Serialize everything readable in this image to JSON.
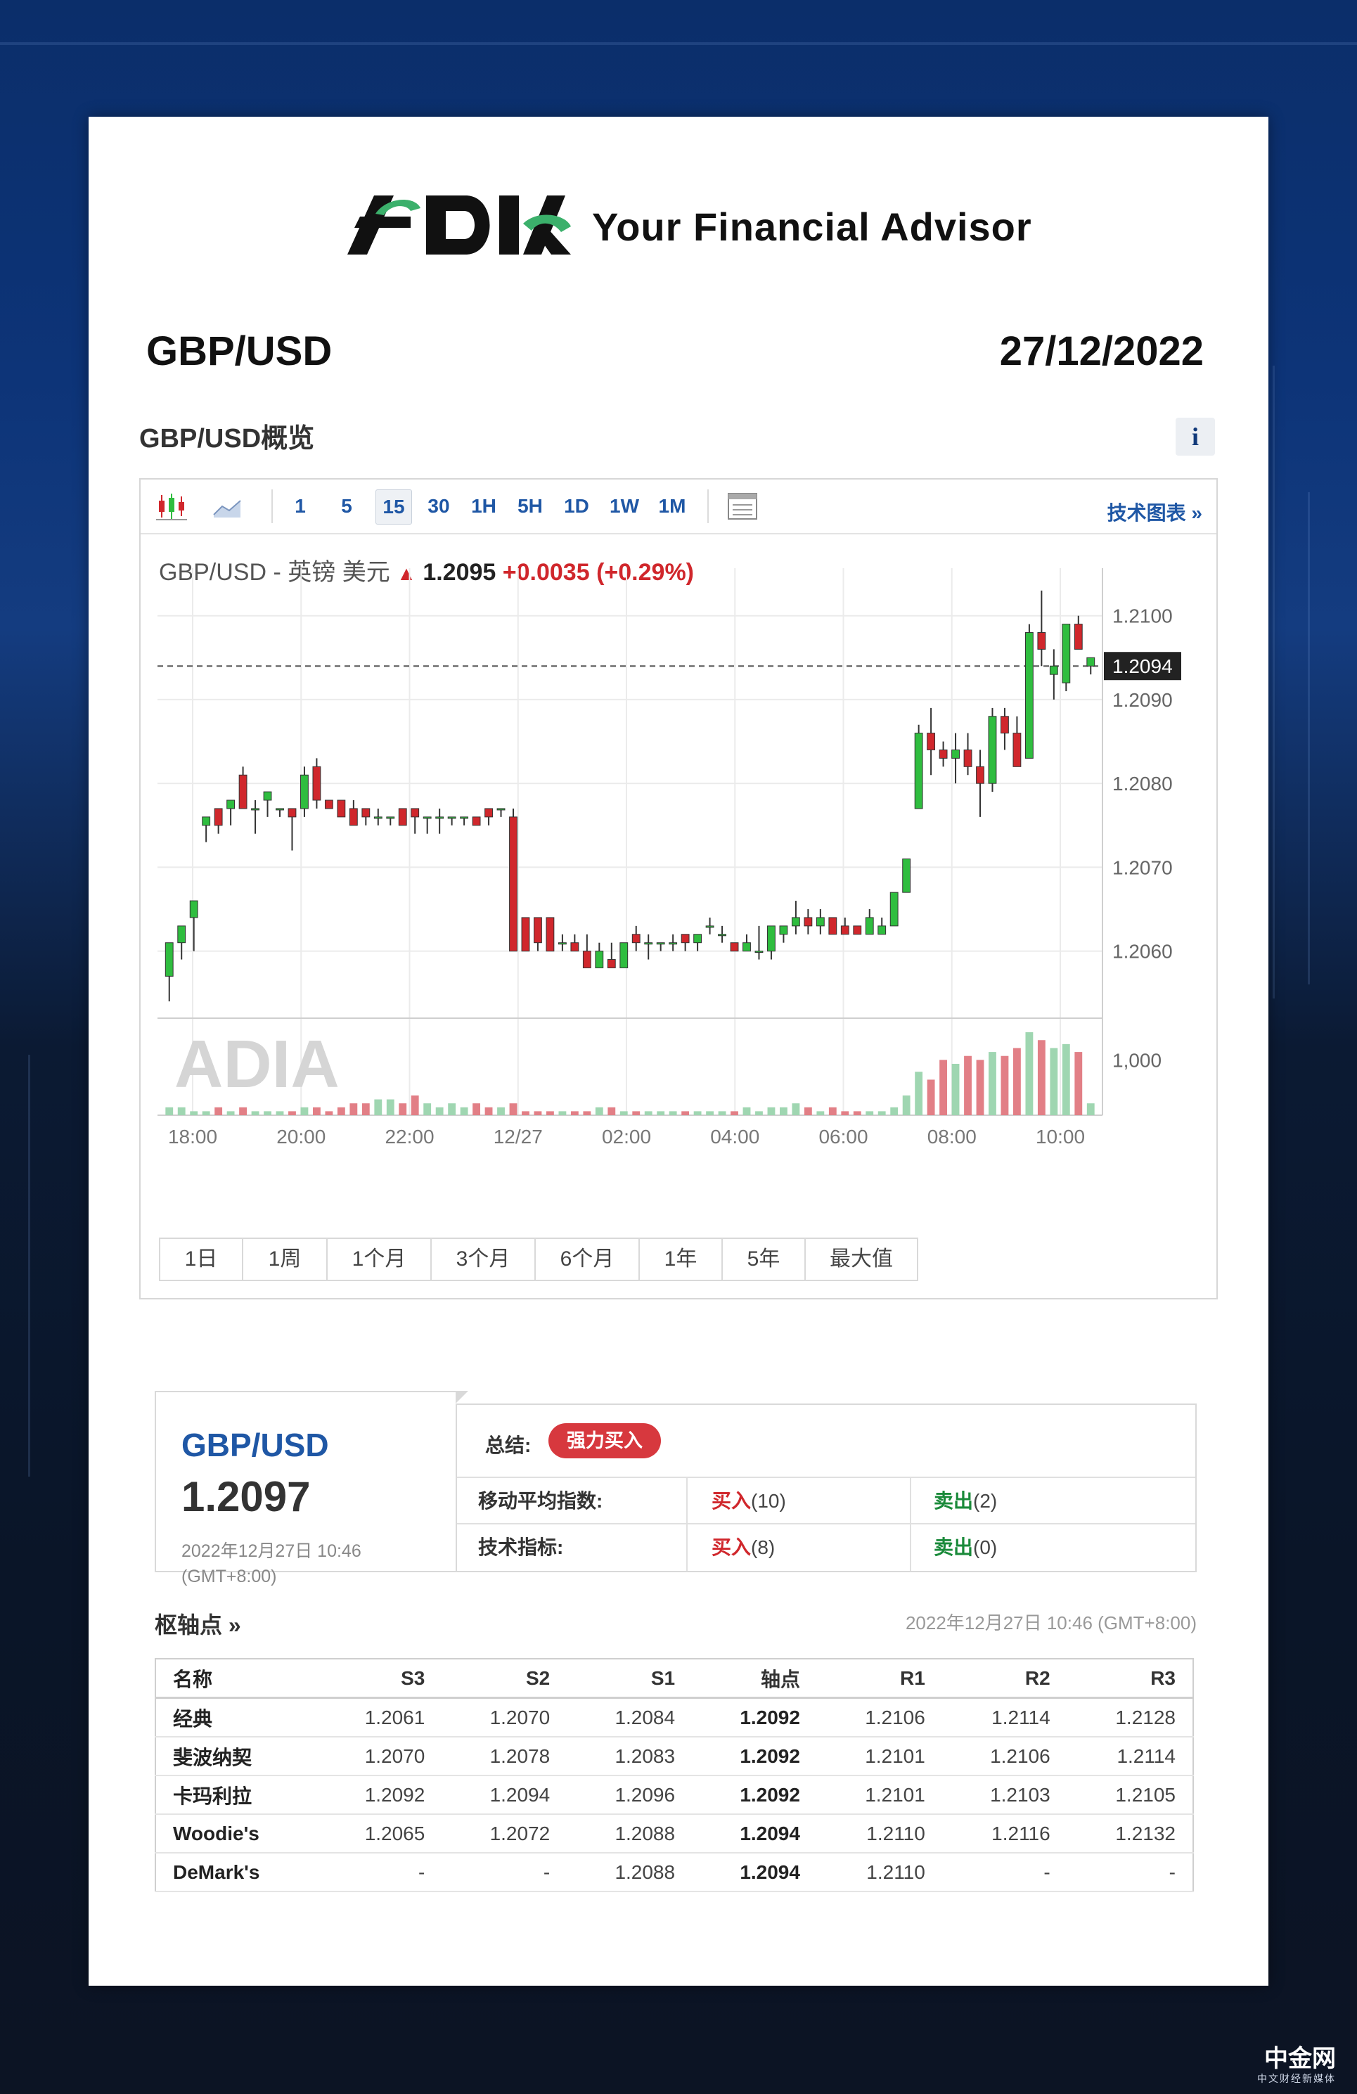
{
  "brand": {
    "tagline": "Your Financial Advisor",
    "logo_text": "ADIA"
  },
  "header": {
    "pair": "GBP/USD",
    "date": "27/12/2022"
  },
  "overview": {
    "title": "GBP/USD概览",
    "info_label": "i"
  },
  "toolbar": {
    "intervals": [
      "1",
      "5",
      "15",
      "30",
      "1H",
      "5H",
      "1D",
      "1W",
      "1M"
    ],
    "active_interval": "15",
    "tech_link": "技术图表 »"
  },
  "quote": {
    "name": "GBP/USD - 英镑 美元",
    "price": "1.2095",
    "change": "+0.0035",
    "change_pct": "(+0.29%)"
  },
  "chart_data": {
    "type": "candlestick",
    "x_tick_labels": [
      "18:00",
      "20:00",
      "22:00",
      "12/27",
      "02:00",
      "04:00",
      "06:00",
      "08:00",
      "10:00"
    ],
    "y_tick_labels": [
      "1.2100",
      "1.2090",
      "1.2080",
      "1.2070",
      "1.2060"
    ],
    "ylim": [
      1.2052,
      1.2104
    ],
    "current_price_label": "1.2094",
    "current_price": 1.2094,
    "volume_tick_label": "1,000",
    "watermark": "ADIA",
    "colors": {
      "up": "#2fbd3f",
      "down": "#d0272c",
      "vol_up": "#9fd6b1",
      "vol_down": "#e27f86",
      "grid": "#ebebeb"
    },
    "candles": [
      {
        "o": 1.2057,
        "h": 1.2061,
        "l": 1.2054,
        "c": 1.2061,
        "v": 2
      },
      {
        "o": 1.2061,
        "h": 1.2063,
        "l": 1.2059,
        "c": 1.2063,
        "v": 2
      },
      {
        "o": 1.2064,
        "h": 1.2066,
        "l": 1.206,
        "c": 1.2066,
        "v": 1
      },
      {
        "o": 1.2075,
        "h": 1.2076,
        "l": 1.2073,
        "c": 1.2076,
        "v": 1
      },
      {
        "o": 1.2077,
        "h": 1.2077,
        "l": 1.2074,
        "c": 1.2075,
        "v": 2
      },
      {
        "o": 1.2077,
        "h": 1.2078,
        "l": 1.2075,
        "c": 1.2078,
        "v": 1
      },
      {
        "o": 1.2081,
        "h": 1.2082,
        "l": 1.2077,
        "c": 1.2077,
        "v": 2
      },
      {
        "o": 1.2077,
        "h": 1.2078,
        "l": 1.2074,
        "c": 1.2077,
        "v": 1
      },
      {
        "o": 1.2078,
        "h": 1.2078,
        "l": 1.2076,
        "c": 1.2079,
        "v": 1
      },
      {
        "o": 1.2077,
        "h": 1.2077,
        "l": 1.2076,
        "c": 1.2077,
        "v": 1
      },
      {
        "o": 1.2077,
        "h": 1.2077,
        "l": 1.2072,
        "c": 1.2076,
        "v": 1
      },
      {
        "o": 1.2077,
        "h": 1.2082,
        "l": 1.2076,
        "c": 1.2081,
        "v": 2
      },
      {
        "o": 1.2082,
        "h": 1.2083,
        "l": 1.2077,
        "c": 1.2078,
        "v": 2
      },
      {
        "o": 1.2078,
        "h": 1.2078,
        "l": 1.2077,
        "c": 1.2077,
        "v": 1
      },
      {
        "o": 1.2078,
        "h": 1.2078,
        "l": 1.2076,
        "c": 1.2076,
        "v": 2
      },
      {
        "o": 1.2077,
        "h": 1.2078,
        "l": 1.2075,
        "c": 1.2075,
        "v": 3
      },
      {
        "o": 1.2077,
        "h": 1.2077,
        "l": 1.2075,
        "c": 1.2076,
        "v": 3
      },
      {
        "o": 1.2076,
        "h": 1.2077,
        "l": 1.2075,
        "c": 1.2076,
        "v": 4
      },
      {
        "o": 1.2076,
        "h": 1.2076,
        "l": 1.2075,
        "c": 1.2076,
        "v": 4
      },
      {
        "o": 1.2077,
        "h": 1.2077,
        "l": 1.2075,
        "c": 1.2075,
        "v": 3
      },
      {
        "o": 1.2077,
        "h": 1.2077,
        "l": 1.2074,
        "c": 1.2076,
        "v": 5
      },
      {
        "o": 1.2076,
        "h": 1.2076,
        "l": 1.2074,
        "c": 1.2076,
        "v": 3
      },
      {
        "o": 1.2076,
        "h": 1.2077,
        "l": 1.2074,
        "c": 1.2076,
        "v": 2
      },
      {
        "o": 1.2076,
        "h": 1.2076,
        "l": 1.2075,
        "c": 1.2076,
        "v": 3
      },
      {
        "o": 1.2076,
        "h": 1.2076,
        "l": 1.2075,
        "c": 1.2076,
        "v": 2
      },
      {
        "o": 1.2076,
        "h": 1.2076,
        "l": 1.2075,
        "c": 1.2075,
        "v": 3
      },
      {
        "o": 1.2077,
        "h": 1.2077,
        "l": 1.2075,
        "c": 1.2076,
        "v": 2
      },
      {
        "o": 1.2077,
        "h": 1.2077,
        "l": 1.2076,
        "c": 1.2077,
        "v": 2
      },
      {
        "o": 1.2076,
        "h": 1.2077,
        "l": 1.206,
        "c": 1.206,
        "v": 3
      },
      {
        "o": 1.2064,
        "h": 1.2064,
        "l": 1.206,
        "c": 1.206,
        "v": 1
      },
      {
        "o": 1.2064,
        "h": 1.2064,
        "l": 1.206,
        "c": 1.2061,
        "v": 1
      },
      {
        "o": 1.2064,
        "h": 1.2064,
        "l": 1.206,
        "c": 1.206,
        "v": 1
      },
      {
        "o": 1.2061,
        "h": 1.2062,
        "l": 1.206,
        "c": 1.2061,
        "v": 1
      },
      {
        "o": 1.2061,
        "h": 1.2062,
        "l": 1.206,
        "c": 1.206,
        "v": 1
      },
      {
        "o": 1.206,
        "h": 1.2062,
        "l": 1.2058,
        "c": 1.2058,
        "v": 1
      },
      {
        "o": 1.2058,
        "h": 1.2061,
        "l": 1.2058,
        "c": 1.206,
        "v": 2
      },
      {
        "o": 1.2059,
        "h": 1.2061,
        "l": 1.2058,
        "c": 1.2058,
        "v": 2
      },
      {
        "o": 1.2058,
        "h": 1.2061,
        "l": 1.2058,
        "c": 1.2061,
        "v": 1
      },
      {
        "o": 1.2062,
        "h": 1.2063,
        "l": 1.206,
        "c": 1.2061,
        "v": 1
      },
      {
        "o": 1.2061,
        "h": 1.2062,
        "l": 1.2059,
        "c": 1.2061,
        "v": 1
      },
      {
        "o": 1.2061,
        "h": 1.2061,
        "l": 1.206,
        "c": 1.2061,
        "v": 1
      },
      {
        "o": 1.2061,
        "h": 1.2062,
        "l": 1.206,
        "c": 1.2061,
        "v": 1
      },
      {
        "o": 1.2062,
        "h": 1.2062,
        "l": 1.206,
        "c": 1.2061,
        "v": 1
      },
      {
        "o": 1.2061,
        "h": 1.2062,
        "l": 1.206,
        "c": 1.2062,
        "v": 1
      },
      {
        "o": 1.2063,
        "h": 1.2064,
        "l": 1.2062,
        "c": 1.2063,
        "v": 1
      },
      {
        "o": 1.2062,
        "h": 1.2063,
        "l": 1.2061,
        "c": 1.2062,
        "v": 1
      },
      {
        "o": 1.2061,
        "h": 1.2061,
        "l": 1.206,
        "c": 1.206,
        "v": 1
      },
      {
        "o": 1.206,
        "h": 1.2062,
        "l": 1.206,
        "c": 1.2061,
        "v": 2
      },
      {
        "o": 1.206,
        "h": 1.2063,
        "l": 1.2059,
        "c": 1.206,
        "v": 1
      },
      {
        "o": 1.206,
        "h": 1.2063,
        "l": 1.2059,
        "c": 1.2063,
        "v": 2
      },
      {
        "o": 1.2062,
        "h": 1.2063,
        "l": 1.2061,
        "c": 1.2063,
        "v": 2
      },
      {
        "o": 1.2063,
        "h": 1.2066,
        "l": 1.2062,
        "c": 1.2064,
        "v": 3
      },
      {
        "o": 1.2064,
        "h": 1.2065,
        "l": 1.2062,
        "c": 1.2063,
        "v": 2
      },
      {
        "o": 1.2063,
        "h": 1.2065,
        "l": 1.2062,
        "c": 1.2064,
        "v": 1
      },
      {
        "o": 1.2064,
        "h": 1.2064,
        "l": 1.2062,
        "c": 1.2062,
        "v": 2
      },
      {
        "o": 1.2063,
        "h": 1.2064,
        "l": 1.2062,
        "c": 1.2062,
        "v": 1
      },
      {
        "o": 1.2063,
        "h": 1.2063,
        "l": 1.2062,
        "c": 1.2062,
        "v": 1
      },
      {
        "o": 1.2062,
        "h": 1.2065,
        "l": 1.2062,
        "c": 1.2064,
        "v": 1
      },
      {
        "o": 1.2062,
        "h": 1.2064,
        "l": 1.2062,
        "c": 1.2063,
        "v": 1
      },
      {
        "o": 1.2063,
        "h": 1.2067,
        "l": 1.2063,
        "c": 1.2067,
        "v": 2
      },
      {
        "o": 1.2067,
        "h": 1.2071,
        "l": 1.2067,
        "c": 1.2071,
        "v": 5
      },
      {
        "o": 1.2077,
        "h": 1.2087,
        "l": 1.2077,
        "c": 1.2086,
        "v": 11
      },
      {
        "o": 1.2086,
        "h": 1.2089,
        "l": 1.2081,
        "c": 1.2084,
        "v": 9
      },
      {
        "o": 1.2084,
        "h": 1.2085,
        "l": 1.2082,
        "c": 1.2083,
        "v": 14
      },
      {
        "o": 1.2083,
        "h": 1.2086,
        "l": 1.208,
        "c": 1.2084,
        "v": 13
      },
      {
        "o": 1.2084,
        "h": 1.2086,
        "l": 1.2081,
        "c": 1.2082,
        "v": 15
      },
      {
        "o": 1.2082,
        "h": 1.2084,
        "l": 1.2076,
        "c": 1.208,
        "v": 14
      },
      {
        "o": 1.208,
        "h": 1.2089,
        "l": 1.2079,
        "c": 1.2088,
        "v": 16
      },
      {
        "o": 1.2088,
        "h": 1.2089,
        "l": 1.2084,
        "c": 1.2086,
        "v": 15
      },
      {
        "o": 1.2086,
        "h": 1.2088,
        "l": 1.2082,
        "c": 1.2082,
        "v": 17
      },
      {
        "o": 1.2083,
        "h": 1.2099,
        "l": 1.2083,
        "c": 1.2098,
        "v": 21
      },
      {
        "o": 1.2098,
        "h": 1.2103,
        "l": 1.2094,
        "c": 1.2096,
        "v": 19
      },
      {
        "o": 1.2093,
        "h": 1.2096,
        "l": 1.209,
        "c": 1.2094,
        "v": 17
      },
      {
        "o": 1.2092,
        "h": 1.2099,
        "l": 1.2091,
        "c": 1.2099,
        "v": 18
      },
      {
        "o": 1.2099,
        "h": 1.21,
        "l": 1.2096,
        "c": 1.2096,
        "v": 16
      },
      {
        "o": 1.2094,
        "h": 1.2095,
        "l": 1.2093,
        "c": 1.2095,
        "v": 3
      }
    ]
  },
  "ranges": [
    "1日",
    "1周",
    "1个月",
    "3个月",
    "6个月",
    "1年",
    "5年",
    "最大值"
  ],
  "summary": {
    "pair": "GBP/USD",
    "price": "1.2097",
    "time_line1": "2022年12月27日 10:46",
    "time_line2": "(GMT+8:00)",
    "label": "总结:",
    "badge": "强力买入",
    "rows": [
      {
        "label": "移动平均指数:",
        "buy": "买入",
        "buy_count": "(10)",
        "sell": "卖出",
        "sell_count": "(2)"
      },
      {
        "label": "技术指标:",
        "buy": "买入",
        "buy_count": "(8)",
        "sell": "卖出",
        "sell_count": "(0)"
      }
    ]
  },
  "pivot": {
    "title": "枢轴点 »",
    "time": "2022年12月27日 10:46 (GMT+8:00)",
    "headers": [
      "名称",
      "S3",
      "S2",
      "S1",
      "轴点",
      "R1",
      "R2",
      "R3"
    ],
    "rows": [
      [
        "经典",
        "1.2061",
        "1.2070",
        "1.2084",
        "1.2092",
        "1.2106",
        "1.2114",
        "1.2128"
      ],
      [
        "斐波纳契",
        "1.2070",
        "1.2078",
        "1.2083",
        "1.2092",
        "1.2101",
        "1.2106",
        "1.2114"
      ],
      [
        "卡玛利拉",
        "1.2092",
        "1.2094",
        "1.2096",
        "1.2092",
        "1.2101",
        "1.2103",
        "1.2105"
      ],
      [
        "Woodie's",
        "1.2065",
        "1.2072",
        "1.2088",
        "1.2094",
        "1.2110",
        "1.2116",
        "1.2132"
      ],
      [
        "DeMark's",
        "-",
        "-",
        "1.2088",
        "1.2094",
        "1.2110",
        "-",
        "-"
      ]
    ]
  },
  "footer": {
    "site": "中金网",
    "site_sub": "中文财经新媒体"
  }
}
